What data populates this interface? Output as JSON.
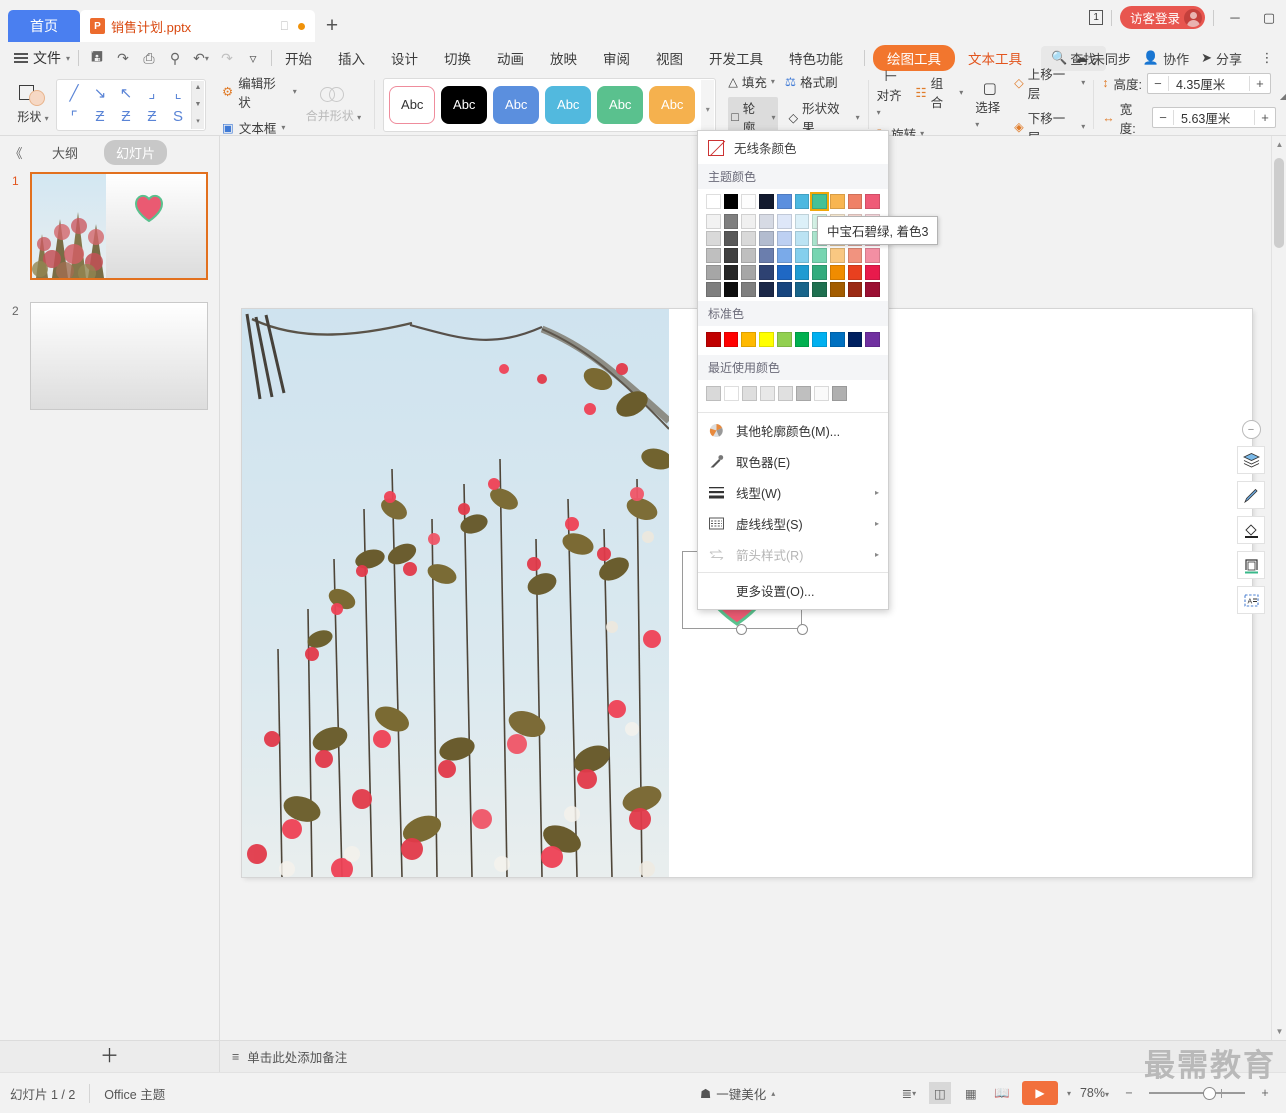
{
  "window": {
    "home_tab": "首页",
    "doc_tab": {
      "name": "销售计划.pptx",
      "icon": "P"
    },
    "new_tab": "+",
    "badge": "1",
    "guest_login": "访客登录",
    "minimize": "－",
    "maximize": "▢",
    "close": "✕"
  },
  "menubar": {
    "file": "文件",
    "quick": [
      "save-icon",
      "save-as-icon",
      "print-icon",
      "print-preview-icon",
      "undo-icon",
      "redo-icon",
      "customize-icon"
    ],
    "items": [
      "开始",
      "插入",
      "设计",
      "切换",
      "动画",
      "放映",
      "审阅",
      "视图",
      "开发工具",
      "特色功能"
    ],
    "drawing_tools": "绘图工具",
    "text_tools": "文本工具",
    "find": "查找",
    "sync": "未同步",
    "collab": "协作",
    "share": "分享"
  },
  "ribbon": {
    "shape_label": "形状",
    "shape_glyphs": [
      "╲",
      "╲",
      "↘",
      "⌐",
      "⌐",
      "⌐",
      "Ƨ",
      "Ƨ",
      "Ƨ",
      "S"
    ],
    "edit_shape": "编辑形状",
    "text_box": "文本框",
    "merge_shape": "合并形状",
    "styles": [
      {
        "label": "Abc",
        "bg": "#ffffff",
        "fg": "#333333",
        "border": "#ef8c9c"
      },
      {
        "label": "Abc",
        "bg": "#000000",
        "fg": "#ffffff",
        "border": "#000000"
      },
      {
        "label": "Abc",
        "bg": "#5b8fde",
        "fg": "#ffffff",
        "border": "#5b8fde"
      },
      {
        "label": "Abc",
        "bg": "#52b9de",
        "fg": "#ffffff",
        "border": "#52b9de"
      },
      {
        "label": "Abc",
        "bg": "#5ac18e",
        "fg": "#ffffff",
        "border": "#5ac18e"
      },
      {
        "label": "Abc",
        "bg": "#f5b14e",
        "fg": "#ffffff",
        "border": "#f5b14e"
      }
    ],
    "fill": "填充",
    "outline": "轮廓",
    "format_painter": "格式刷",
    "shape_effects": "形状效果",
    "align": "对齐",
    "group": "组合",
    "rotate": "旋转",
    "select": "选择",
    "bring_forward": "上移一层",
    "send_backward": "下移一层",
    "height_label": "高度:",
    "height_value": "4.35厘米",
    "width_label": "宽度:",
    "width_value": "5.63厘米",
    "minus": "−",
    "plus": "+"
  },
  "sidebar": {
    "collapse": "《",
    "tab_outline": "大纲",
    "tab_slides": "幻灯片",
    "slides": [
      {
        "num": "1",
        "selected": true
      },
      {
        "num": "2",
        "selected": false
      }
    ]
  },
  "dropdown": {
    "no_color": "无线条颜色",
    "theme_colors_label": "主题颜色",
    "theme_row1": [
      "#ffffff",
      "#000000",
      "#fdfdfd",
      "#121a2e",
      "#5b8fde",
      "#4cb8e0",
      "#44c196",
      "#f8b551",
      "#ef8167",
      "#ef5a77"
    ],
    "theme_rows": [
      [
        "#f2f2f2",
        "#7f7f7f",
        "#f0f0f0",
        "#d6dae4",
        "#dee7f8",
        "#dcf0f8",
        "#d5f2e6",
        "#fdeed6",
        "#fbdcd6",
        "#fbd9e0"
      ],
      [
        "#d9d9d9",
        "#595959",
        "#d9d9d9",
        "#b3bccf",
        "#bdd0f2",
        "#bbe3f3",
        "#abe5ce",
        "#fbdcad",
        "#f6b9ad",
        "#f7b4c1"
      ],
      [
        "#bfbfbf",
        "#404040",
        "#bfbfbf",
        "#6b7ead",
        "#7aaae9",
        "#84cfed",
        "#77d5b1",
        "#f9c882",
        "#f1937f",
        "#f38fa3"
      ],
      [
        "#a6a6a6",
        "#262626",
        "#a6a6a6",
        "#2e4272",
        "#1f68c4",
        "#1f9bd2",
        "#33ab7d",
        "#f08c00",
        "#e8401f",
        "#e81a4c"
      ],
      [
        "#7f7f7f",
        "#0d0d0d",
        "#7f7f7f",
        "#1b2848",
        "#17457f",
        "#18648a",
        "#1f7050",
        "#a35c00",
        "#9b2a14",
        "#9b1033"
      ]
    ],
    "selected_theme_index": 6,
    "standard_colors_label": "标准色",
    "standard_colors": [
      "#c00000",
      "#ff0000",
      "#ffb900",
      "#ffff00",
      "#92d050",
      "#00b050",
      "#00b0f0",
      "#0070c0",
      "#002060",
      "#7030a0"
    ],
    "recent_colors_label": "最近使用颜色",
    "recent_colors": [
      "#d9d9d9",
      "#ffffff",
      "#dedede",
      "#e8e8e8",
      "#e0e0e0",
      "#bfbfbf",
      "#fafafa",
      "#b0b0b0"
    ],
    "items": [
      {
        "label": "其他轮廓颜色(M)...",
        "icon": "color-wheel-icon",
        "arrow": false,
        "disabled": false
      },
      {
        "label": "取色器(E)",
        "icon": "eyedropper-icon",
        "arrow": false,
        "disabled": false
      },
      {
        "label": "线型(W)",
        "icon": "line-weight-icon",
        "arrow": true,
        "disabled": false
      },
      {
        "label": "虚线线型(S)",
        "icon": "dash-style-icon",
        "arrow": true,
        "disabled": false
      },
      {
        "label": "箭头样式(R)",
        "icon": "arrow-style-icon",
        "arrow": true,
        "disabled": true
      },
      {
        "label": "更多设置(O)...",
        "icon": "",
        "arrow": false,
        "disabled": false
      }
    ],
    "tooltip": "中宝石碧绿, 着色3"
  },
  "floatbar": {
    "collapse": "−",
    "buttons": [
      "layers-icon",
      "brush-icon",
      "fill-bucket-icon",
      "frame-icon",
      "text-alt-icon"
    ]
  },
  "bottom": {
    "add_slide": "＋",
    "notes_placeholder": "单击此处添加备注",
    "slide_count": "幻灯片 1 / 2",
    "theme": "Office 主题",
    "beautify": "一键美化",
    "zoom": "78%",
    "zoom_out": "−",
    "zoom_in": "+",
    "views": [
      "normal-view-icon",
      "sorter-view-icon",
      "reading-view-icon"
    ],
    "play": "▶"
  },
  "watermark": "最需教育"
}
